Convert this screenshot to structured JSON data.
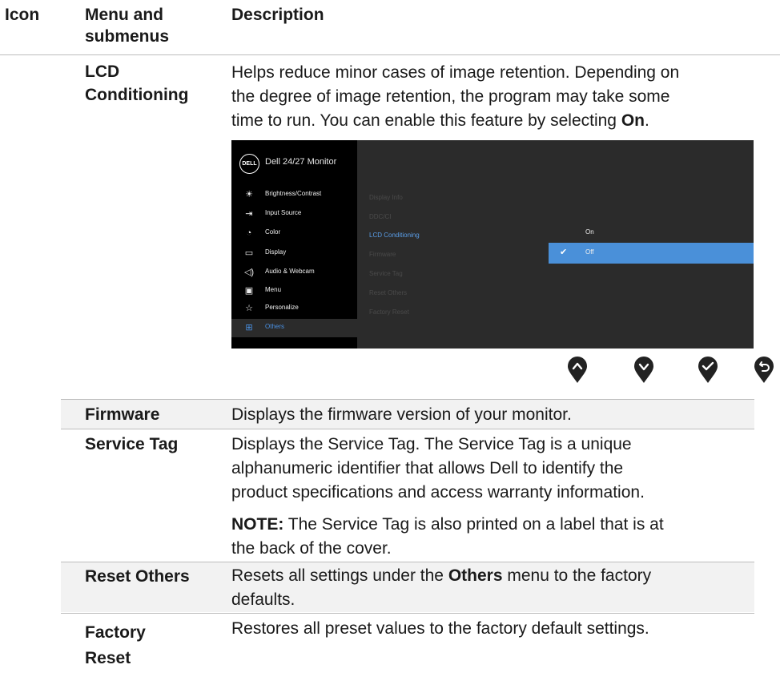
{
  "header": {
    "col_icon": "Icon",
    "col_menu_line1": "Menu and",
    "col_menu_line2": "submenus",
    "col_desc": "Description"
  },
  "lcd": {
    "label_line1": "LCD",
    "label_line2": "Conditioning",
    "desc_line1": "Helps reduce minor cases of image retention. Depending on",
    "desc_line2": "the degree of image retention, the program may take some",
    "desc_line3_pre": "time to run. You can enable this feature by selecting ",
    "desc_line3_bold": "On",
    "desc_line3_post": "."
  },
  "osd": {
    "logo": "DELL",
    "title": "Dell 24/27 Monitor",
    "menu": [
      {
        "icon": "brightness-icon",
        "label": "Brightness/Contrast"
      },
      {
        "icon": "input-source-icon",
        "label": "Input Source"
      },
      {
        "icon": "color-icon",
        "label": "Color"
      },
      {
        "icon": "display-icon",
        "label": "Display"
      },
      {
        "icon": "audio-webcam-icon",
        "label": "Audio & Webcam"
      },
      {
        "icon": "menu-icon",
        "label": "Menu"
      },
      {
        "icon": "star-icon",
        "label": "Personalize"
      },
      {
        "icon": "others-icon",
        "label": "Others"
      }
    ],
    "submenu": [
      "Display Info",
      "DDC/CI",
      "LCD Conditioning",
      "Firmware",
      "Service Tag",
      "Reset Others",
      "Factory Reset"
    ],
    "options": [
      "On",
      "Off"
    ],
    "active_menu": "Others",
    "active_submenu": "LCD Conditioning",
    "selected_option": "Off",
    "accent": "#4a90d9"
  },
  "nav_buttons": [
    "up-icon",
    "down-icon",
    "check-icon",
    "back-icon"
  ],
  "firmware": {
    "label": "Firmware",
    "desc": "Displays the firmware version of your monitor."
  },
  "service_tag": {
    "label": "Service Tag",
    "desc_line1": "Displays the Service Tag. The Service Tag is a unique",
    "desc_line2": "alphanumeric identifier that allows Dell to identify the",
    "desc_line3": "product specifications and access warranty information.",
    "note_bold": "NOTE:",
    "note_line1": " The Service Tag is also printed on a label that is at",
    "note_line2": "the back of the cover."
  },
  "reset_others": {
    "label": "Reset Others",
    "desc_pre": "Resets all settings under the ",
    "desc_bold": "Others",
    "desc_post": " menu to the factory",
    "desc_line2": "defaults."
  },
  "factory_reset": {
    "label_line1": "Factory",
    "label_line2": "Reset",
    "desc": "Restores all preset values to the factory default settings."
  }
}
